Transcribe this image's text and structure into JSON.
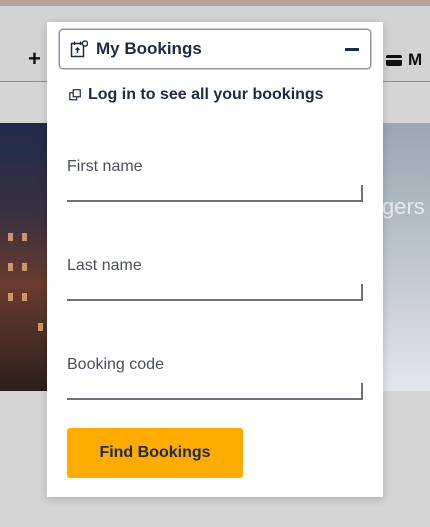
{
  "background": {
    "hero_text": "gers",
    "menu_text": "M",
    "plus_symbol": "+"
  },
  "panel": {
    "title": "My Bookings",
    "collapse_icon": "minus-icon",
    "title_icon": "booking-calendar-icon",
    "login_link": {
      "label": "Log in to see all your bookings",
      "icon": "external-link-icon"
    },
    "fields": {
      "first_name": {
        "label": "First name",
        "value": ""
      },
      "last_name": {
        "label": "Last name",
        "value": ""
      },
      "booking_code": {
        "label": "Booking code",
        "value": ""
      }
    },
    "submit_label": "Find Bookings"
  },
  "colors": {
    "accent": "#ffab00",
    "text_dark": "#1f2a44",
    "label": "#4a4f5c"
  }
}
